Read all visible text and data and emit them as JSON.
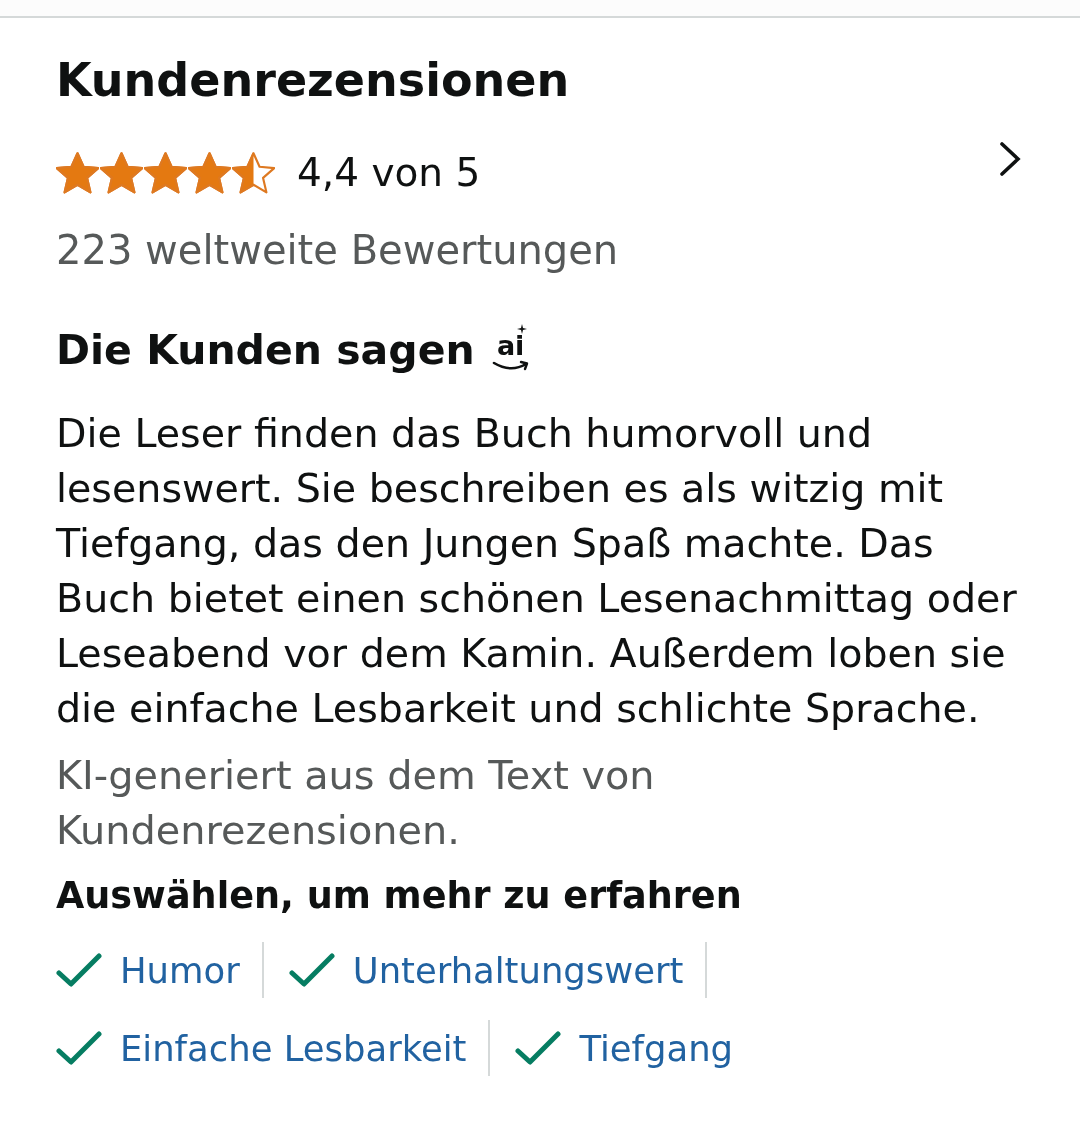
{
  "section_title": "Kundenrezensionen",
  "rating": {
    "stars": 4.5,
    "text": "4,4 von 5"
  },
  "ratings_count": "223 weltweite Bewertungen",
  "summary": {
    "title": "Die Kunden sagen",
    "ai_logo": "ai",
    "text": "Die Leser finden das Buch humorvoll und lesenswert. Sie beschreiben es als witzig mit Tiefgang, das den Jungen Spaß machte. Das Buch bietet einen schönen Lesenachmittag oder Leseabend vor dem Kamin. Außerdem loben sie die einfache Lesbarkeit und schlichte Sprache.",
    "note": "KI-generiert aus dem Text von Kundenrezensionen."
  },
  "aspects": {
    "title": "Auswählen, um mehr zu erfahren",
    "items": [
      {
        "label": "Humor"
      },
      {
        "label": "Unterhaltungswert"
      },
      {
        "label": "Einfache Lesbarkeit"
      },
      {
        "label": "Tiefgang"
      }
    ]
  }
}
